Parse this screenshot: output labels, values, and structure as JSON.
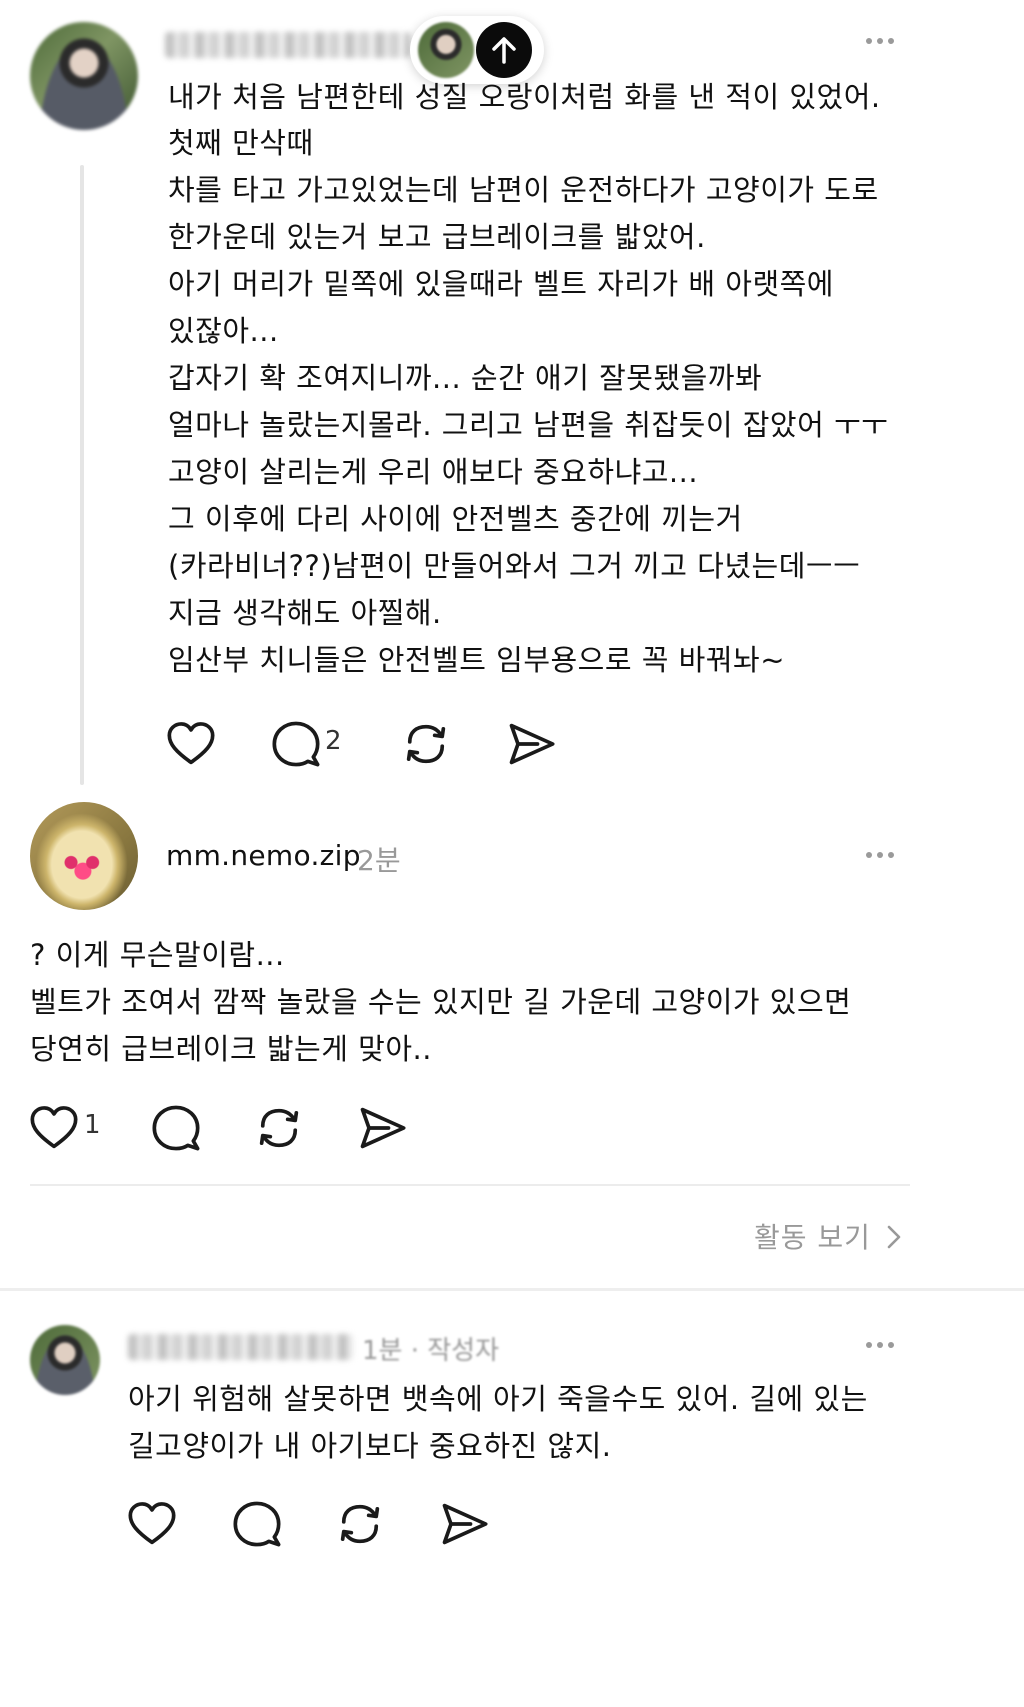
{
  "post1": {
    "author": "",
    "body_lines": [
      "내가 처음 남편한테 성질 오랑이처럼 화를 낸 적이 있었어.",
      "첫째 만삭때",
      "차를 타고 가고있었는데 남편이 운전하다가 고양이가 도로",
      "한가운데 있는거 보고 급브레이크를 밟았어.",
      "아기 머리가 밑쪽에 있을때라 벨트 자리가 배 아랫쪽에",
      "있잖아...",
      "갑자기 확 조여지니까... 순간 애기 잘못됐을까봐",
      "얼마나 놀랐는지몰라. 그리고 남편을 취잡듯이 잡았어 ㅜㅜ",
      "고양이 살리는게 우리 애보다 중요하냐고...",
      "그 이후에 다리 사이에 안전벨츠 중간에 끼는거",
      "(카라비너??)남편이 만들어와서 그거 끼고 다녔는데ㅡㅡ",
      "지금 생각해도 아찔해.",
      "임산부 치니들은 안전벨트 임부용으로 꼭 바꿔놔~"
    ],
    "like_count": "",
    "reply_count": "2"
  },
  "post2": {
    "author": "mm.nemo.zip",
    "time": "2분",
    "body_lines": [
      "? 이게 무슨말이람...",
      "벨트가 조여서 깜짝 놀랐을 수는 있지만 길 가운데 고양이가 있으면",
      "당연히 급브레이크 밟는게 맞아.."
    ],
    "like_count": "1",
    "reply_count": ""
  },
  "activity_link": "활동 보기",
  "post3": {
    "author": "",
    "meta": "1분 · 작성자",
    "body_lines": [
      "아기 위험해 살못하면 뱃속에 아기 죽을수도 있어. 길에 있는",
      "길고양이가 내 아기보다 중요하진 않지."
    ]
  },
  "icons": {
    "like": "heart-icon",
    "reply": "comment-bubble-icon",
    "repost": "repost-icon",
    "share": "send-icon",
    "scroll_top": "arrow-up-icon",
    "more": "more-dots-icon",
    "chevron": "chevron-right-icon"
  },
  "colors": {
    "text": "#111111",
    "muted": "#999999",
    "icon": "#1a1a1a",
    "divider": "#ececec"
  }
}
